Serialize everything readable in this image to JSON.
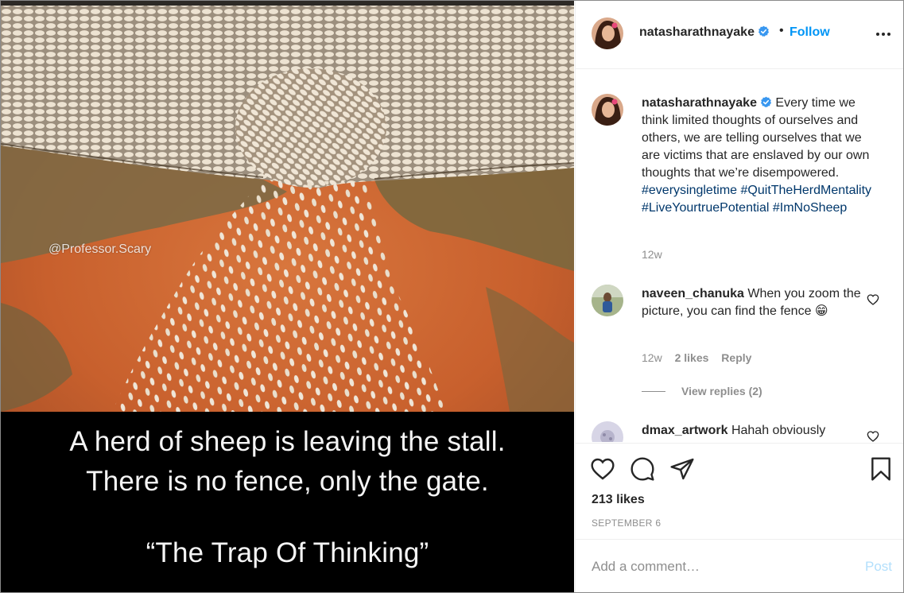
{
  "media": {
    "watermark": "@Professor.Scary",
    "caption_lines": [
      "A herd of sheep is leaving the stall.",
      "There is no fence, only the gate.",
      "“The Trap Of Thinking”"
    ]
  },
  "header": {
    "username": "natasharathnayake",
    "verified_icon": "verified-badge-icon",
    "separator": "•",
    "follow_label": "Follow",
    "more_icon": "more-options-icon"
  },
  "caption": {
    "username": "natasharathnayake",
    "text": "Every time we think limited thoughts of ourselves and others, we are telling ourselves that we are victims that are enslaved by our own thoughts that we’re disempowered.",
    "hashtags": [
      "#everysingletime",
      "#QuitTheHerdMentality",
      "#LiveYourtruePotential",
      "#ImNoSheep"
    ],
    "age": "12w"
  },
  "comments": [
    {
      "username": "naveen_chanuka",
      "text": "When you zoom the picture, you can find the fence",
      "emoji": "😁",
      "age": "12w",
      "likes": "2 likes",
      "reply_label": "Reply",
      "view_replies": "View replies (2)"
    },
    {
      "username": "dmax_artwork",
      "text": "Hahah obviously"
    }
  ],
  "actions": {
    "like_icon": "heart-icon",
    "comment_icon": "comment-icon",
    "share_icon": "share-icon",
    "save_icon": "bookmark-icon",
    "likes": "213 likes",
    "date": "SEPTEMBER 6"
  },
  "add_comment": {
    "placeholder": "Add a comment…",
    "post_label": "Post"
  },
  "colors": {
    "link_blue": "#0095f6",
    "hashtag": "#00376b",
    "post_disabled": "#b2dffc",
    "muted": "#8e8e8e",
    "earth": "#c9602c"
  }
}
